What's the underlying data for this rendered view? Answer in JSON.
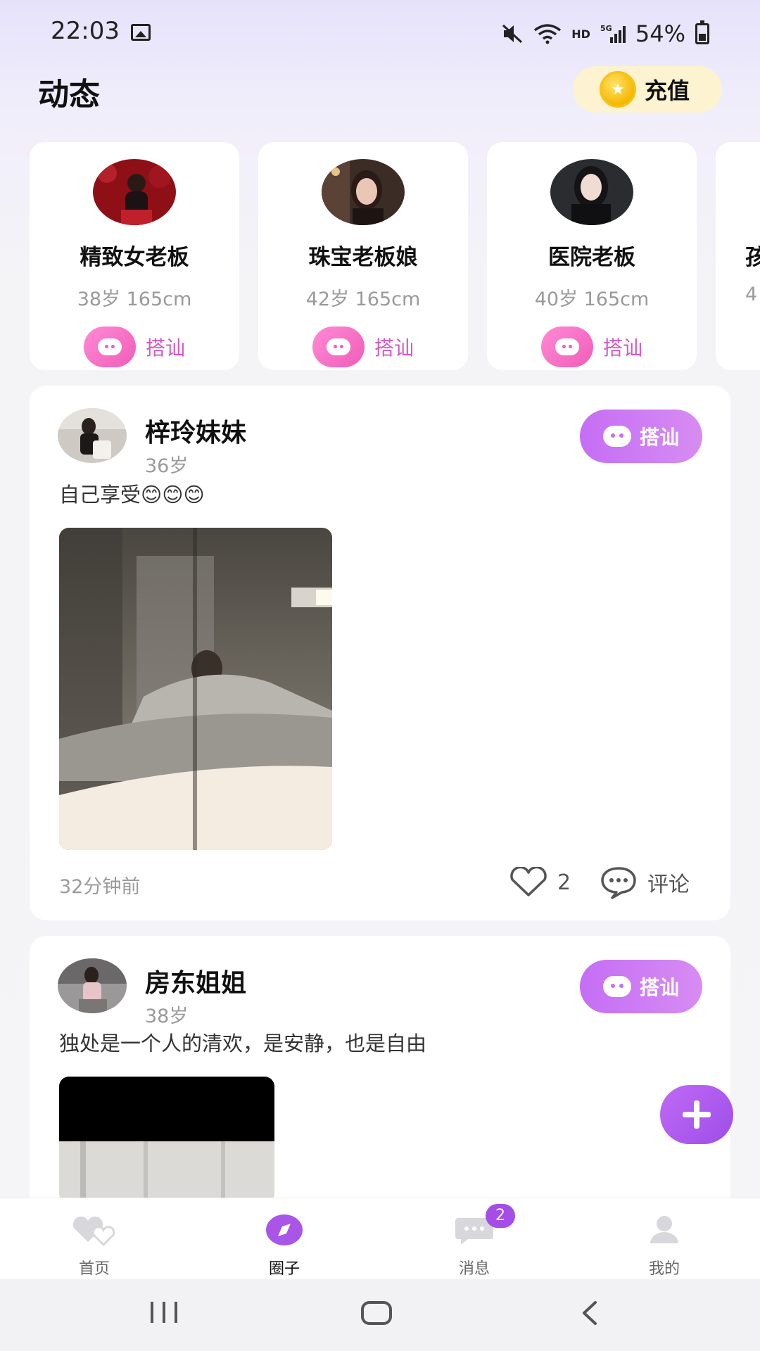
{
  "status_bar": {
    "time": "22:03",
    "hd": "HD",
    "network": "5G",
    "battery": "54%"
  },
  "header": {
    "title": "动态",
    "recharge_label": "充值"
  },
  "profiles": [
    {
      "name": "精致女老板",
      "meta": "38岁 165cm",
      "chat_label": "搭讪"
    },
    {
      "name": "珠宝老板娘",
      "meta": "42岁 165cm",
      "chat_label": "搭讪"
    },
    {
      "name": "医院老板",
      "meta": "40岁 165cm",
      "chat_label": "搭讪"
    },
    {
      "name": "孩",
      "meta": "4",
      "chat_label": ""
    }
  ],
  "posts": [
    {
      "name": "梓玲妹妹",
      "age": "36岁",
      "text": "自己享受😊😊😊",
      "chat_label": "搭讪",
      "time": "32分钟前",
      "likes": "2",
      "comment_label": "评论"
    },
    {
      "name": "房东姐姐",
      "age": "38岁",
      "text": "独处是一个人的清欢，是安静，也是自由",
      "chat_label": "搭讪"
    }
  ],
  "bottom_nav": [
    {
      "label": "首页",
      "icon": "hearts-icon"
    },
    {
      "label": "圈子",
      "icon": "compass-icon",
      "active": true
    },
    {
      "label": "消息",
      "icon": "message-icon",
      "badge": "2"
    },
    {
      "label": "我的",
      "icon": "profile-icon"
    }
  ],
  "colors": {
    "accent": "#c56ef5",
    "pink": "#f05db8",
    "coin_bg": "#fdf3d0"
  }
}
